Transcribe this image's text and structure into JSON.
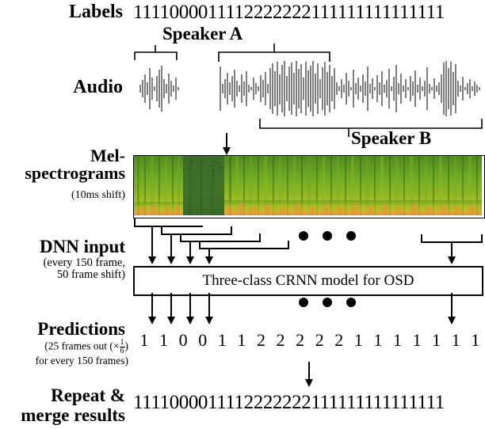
{
  "figure": {
    "type": "pipeline-diagram",
    "topic": "Three-class CRNN overlapped speech detection (OSD) pipeline"
  },
  "rows": {
    "labels": {
      "title": "Labels",
      "sequence": "1111000011112222222111111111111111"
    },
    "audio": {
      "title": "Audio",
      "speaker_a": "Speaker A",
      "speaker_b": "Speaker B"
    },
    "mel": {
      "title_line1": "Mel-",
      "title_line2": "spectrograms",
      "subtitle": "(10ms shift)"
    },
    "dnn": {
      "title": "DNN input",
      "subtitle_line1": "(every 150 frame,",
      "subtitle_line2": "50 frame shift)",
      "model_box_label": "Three-class CRNN model for OSD"
    },
    "predictions": {
      "title": "Predictions",
      "subtitle_line1_pre": "(25 frames out (×",
      "subtitle_frac_num": "1",
      "subtitle_frac_den": "6",
      "subtitle_line1_post": ")",
      "subtitle_line2": "for every 150 frames)",
      "values": [
        "1",
        "1",
        "0",
        "0",
        "1",
        "1",
        "2",
        "2",
        "2",
        "2",
        "2",
        "1",
        "1",
        "1",
        "1",
        "1",
        "1",
        "1"
      ]
    },
    "repeat": {
      "title_line1": "Repeat &",
      "title_line2": "merge results",
      "sequence": "1111000011112222222111111111111111"
    }
  },
  "ellipsis": {
    "dots": "● ● ●"
  },
  "colors": {
    "ink": "#000000",
    "background": "#ffffff",
    "spectrogram_green": "#5a9a20",
    "spectrogram_dark": "#3d6b2a",
    "spectrogram_yellow": "#c9d424",
    "spectrogram_orange": "#e8903a"
  }
}
